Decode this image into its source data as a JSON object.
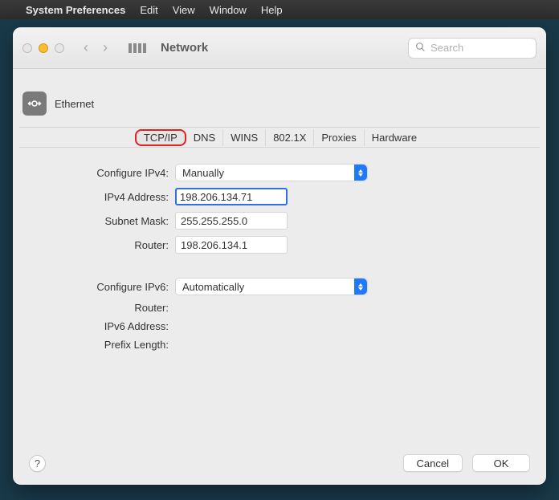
{
  "menubar": {
    "app": "System Preferences",
    "items": [
      "Edit",
      "View",
      "Window",
      "Help"
    ]
  },
  "window": {
    "title": "Network",
    "search_placeholder": "Search"
  },
  "sheet": {
    "title": "Ethernet",
    "tabs": [
      "TCP/IP",
      "DNS",
      "WINS",
      "802.1X",
      "Proxies",
      "Hardware"
    ],
    "active_tab": "TCP/IP",
    "labels": {
      "configure_ipv4": "Configure IPv4:",
      "ipv4_address": "IPv4 Address:",
      "subnet_mask": "Subnet Mask:",
      "router4": "Router:",
      "configure_ipv6": "Configure IPv6:",
      "router6": "Router:",
      "ipv6_address": "IPv6 Address:",
      "prefix_length": "Prefix Length:"
    },
    "values": {
      "configure_ipv4": "Manually",
      "ipv4_address": "198.206.134.71",
      "subnet_mask": "255.255.255.0",
      "router4": "198.206.134.1",
      "configure_ipv6": "Automatically",
      "router6": "",
      "ipv6_address": "",
      "prefix_length": ""
    },
    "buttons": {
      "cancel": "Cancel",
      "ok": "OK",
      "help": "?"
    }
  }
}
